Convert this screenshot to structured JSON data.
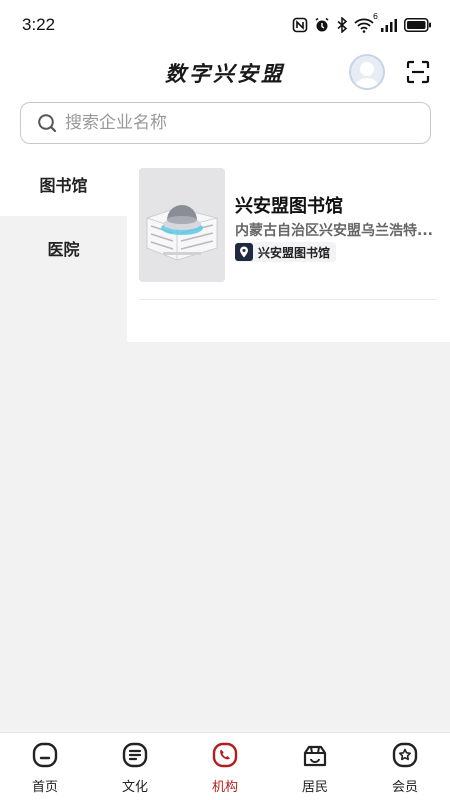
{
  "status": {
    "time": "3:22",
    "network": "6"
  },
  "header": {
    "title": "数字兴安盟"
  },
  "search": {
    "placeholder": "搜索企业名称"
  },
  "sidebar": {
    "items": [
      {
        "label": "图书馆",
        "active": true
      },
      {
        "label": "医院",
        "active": false
      }
    ]
  },
  "listing": {
    "items": [
      {
        "title": "兴安盟图书馆",
        "address": "内蒙古自治区兴安盟乌兰浩特...",
        "tag": "兴安盟图书馆"
      }
    ]
  },
  "tabbar": {
    "items": [
      {
        "label": "首页",
        "icon": "home-icon"
      },
      {
        "label": "文化",
        "icon": "culture-icon"
      },
      {
        "label": "机构",
        "icon": "institution-icon",
        "active": true
      },
      {
        "label": "居民",
        "icon": "residents-icon"
      },
      {
        "label": "会员",
        "icon": "member-icon"
      }
    ]
  },
  "colors": {
    "accent": "#b51d1d",
    "background": "#f2f2f2",
    "tag_icon_bg": "#1f2940"
  }
}
